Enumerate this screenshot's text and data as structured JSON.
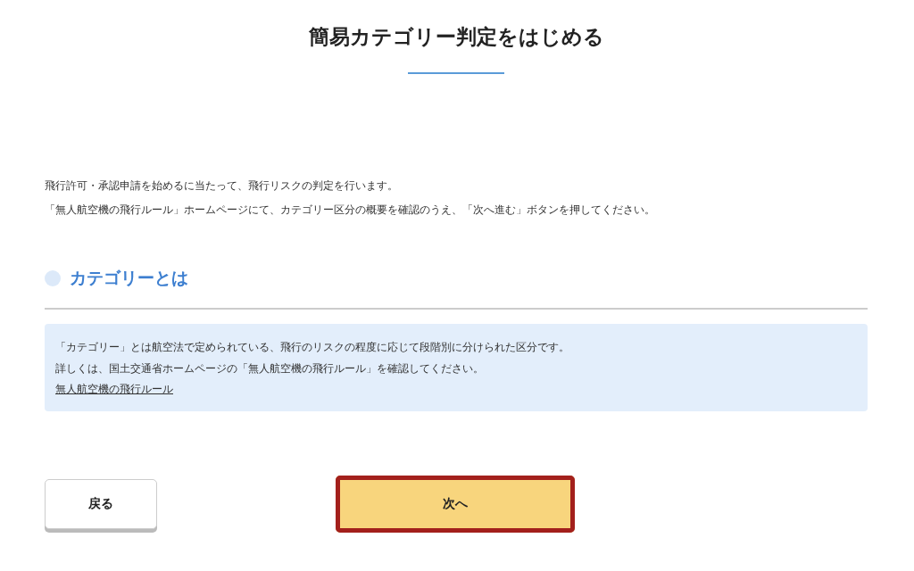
{
  "title": "簡易カテゴリー判定をはじめる",
  "intro": [
    "飛行許可・承認申請を始めるに当たって、飛行リスクの判定を行います。",
    "「無人航空機の飛行ルール」ホームページにて、カテゴリー区分の概要を確認のうえ、「次へ進む」ボタンを押してください。"
  ],
  "section": {
    "heading": "カテゴリーとは",
    "info": [
      "「カテゴリー」とは航空法で定められている、飛行のリスクの程度に応じて段階別に分けられた区分です。",
      "詳しくは、国土交通省ホームページの「無人航空機の飛行ルール」を確認してください。"
    ],
    "link": "無人航空機の飛行ルール"
  },
  "buttons": [
    {
      "kind": "secondary",
      "label": "戻る",
      "highlighted": false
    },
    {
      "kind": "primary",
      "label": "次へ",
      "highlighted": true
    }
  ]
}
